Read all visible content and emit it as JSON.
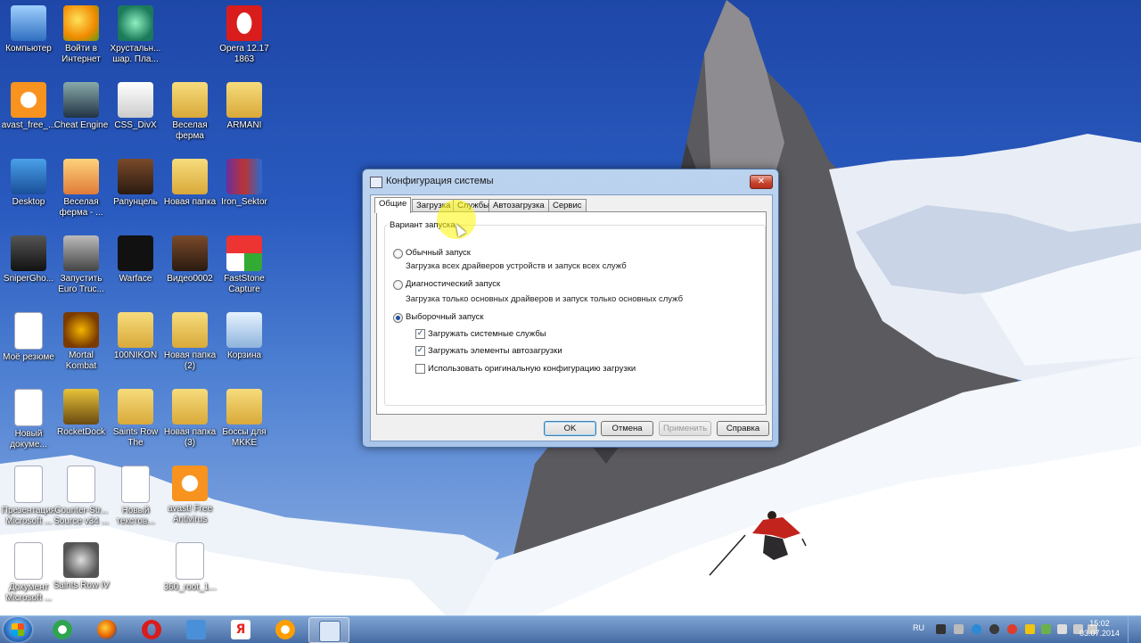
{
  "desktop": {
    "icons": [
      {
        "label": "Компьютер",
        "icon": "computer-icon"
      },
      {
        "label": "Войти в Интернет",
        "icon": "internet-icon"
      },
      {
        "label": "Хрустальн... шар. Пла...",
        "icon": "crystal-ball-icon"
      },
      {
        "label": "Opera 12.17 1863",
        "icon": "opera-icon"
      },
      {
        "label": "avast_free_...",
        "icon": "avast-icon"
      },
      {
        "label": "Cheat Engine",
        "icon": "cheat-engine-icon"
      },
      {
        "label": "CSS_DivX",
        "icon": "css-icon"
      },
      {
        "label": "Веселая ферма",
        "icon": "folder-icon"
      },
      {
        "label": "ARMANI",
        "icon": "folder-icon"
      },
      {
        "label": "Desktop",
        "icon": "desktop-icon"
      },
      {
        "label": "Веселая ферма - ...",
        "icon": "farm-icon"
      },
      {
        "label": "Рапунцель",
        "icon": "video-icon"
      },
      {
        "label": "Новая папка",
        "icon": "folder-icon"
      },
      {
        "label": "Iron_Sektor",
        "icon": "winrar-icon"
      },
      {
        "label": "SniperGho...",
        "icon": "sniper-icon"
      },
      {
        "label": "Запустить Euro Truc...",
        "icon": "truck-icon"
      },
      {
        "label": "Warface",
        "icon": "warface-icon"
      },
      {
        "label": "Видео0002",
        "icon": "video-icon"
      },
      {
        "label": "FastStone Capture",
        "icon": "faststone-icon"
      },
      {
        "label": "Моё резюме",
        "icon": "word-doc-icon"
      },
      {
        "label": "Mortal Kombat",
        "icon": "mortal-kombat-icon"
      },
      {
        "label": "100NIKON",
        "icon": "folder-icon"
      },
      {
        "label": "Новая папка (2)",
        "icon": "folder-icon"
      },
      {
        "label": "Корзина",
        "icon": "recycle-bin-icon"
      },
      {
        "label": "Новый докуме...",
        "icon": "document-icon"
      },
      {
        "label": "RocketDock",
        "icon": "rocketdock-icon"
      },
      {
        "label": "Saints Row The",
        "icon": "folder-icon"
      },
      {
        "label": "Новая папка (3)",
        "icon": "folder-icon"
      },
      {
        "label": "Боссы для MKKE",
        "icon": "folder-icon"
      },
      {
        "label": "Презентация Microsoft ...",
        "icon": "presentation-icon"
      },
      {
        "label": "Counter-Str... Source v34 ...",
        "icon": "file-icon"
      },
      {
        "label": "Новый текстов...",
        "icon": "text-file-icon"
      },
      {
        "label": "avast! Free Antivirus",
        "icon": "avast-icon"
      },
      {
        "label": "Документ Microsoft ...",
        "icon": "word-doc-icon"
      },
      {
        "label": "Saints Row IV",
        "icon": "saints-row-icon"
      },
      {
        "label": "360_root_1...",
        "icon": "file-icon"
      }
    ]
  },
  "dialog": {
    "title": "Конфигурация системы",
    "close_label": "✕",
    "tabs": [
      "Общие",
      "Загрузка",
      "Службы",
      "Автозагрузка",
      "Сервис"
    ],
    "active_tab": "Общие",
    "group_label": "Вариант запуска",
    "options": [
      {
        "label": "Обычный запуск",
        "desc": "Загрузка всех драйверов устройств и запуск всех служб",
        "selected": false
      },
      {
        "label": "Диагностический запуск",
        "desc": "Загрузка только основных драйверов и запуск только основных служб",
        "selected": false
      },
      {
        "label": "Выборочный запуск",
        "desc": "",
        "selected": true
      }
    ],
    "checkboxes": [
      {
        "label": "Загружать системные службы",
        "checked": true
      },
      {
        "label": "Загружать элементы автозагрузки",
        "checked": true
      },
      {
        "label": "Использовать оригинальную конфигурацию загрузки",
        "checked": false
      }
    ],
    "buttons": {
      "ok": "OK",
      "cancel": "Отмена",
      "apply": "Применить",
      "help": "Справка"
    }
  },
  "taskbar": {
    "pinned": [
      "mail-agent-icon",
      "firefox-icon",
      "opera-icon",
      "audio-icon",
      "yandex-icon",
      "mail-ru-icon",
      "msconfig-icon"
    ],
    "language": "RU",
    "time": "15:02",
    "date": "03.07.2014"
  },
  "colors": {
    "accent": "#1c4fa4",
    "wallpaper_sky": "#2a5bc0"
  }
}
